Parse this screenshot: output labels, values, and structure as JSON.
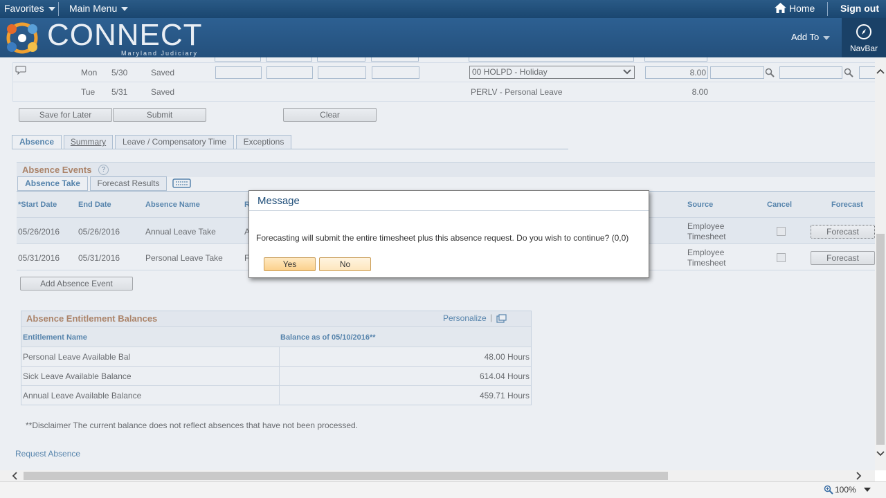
{
  "topbar": {
    "favorites": "Favorites",
    "main_menu": "Main Menu",
    "home": "Home",
    "sign_out": "Sign out"
  },
  "banner": {
    "logo": "CONNECT",
    "logo_sub": "Maryland Judiciary",
    "add_to": "Add To",
    "navbar": "NavBar"
  },
  "timesheet_rows": [
    {
      "day": "Mon",
      "date": "5/30",
      "status": "Saved",
      "trc": "00 HOLPD - Holiday",
      "qty": "8.00"
    },
    {
      "day": "Tue",
      "date": "5/31",
      "status": "Saved",
      "trc": "PERLV - Personal Leave",
      "qty": "8.00"
    }
  ],
  "buttons": {
    "save_later": "Save for Later",
    "submit": "Submit",
    "clear": "Clear",
    "add_absence": "Add Absence Event",
    "forecast": "Forecast"
  },
  "tabs": [
    {
      "label": "Absence"
    },
    {
      "label": "Summary"
    },
    {
      "label": "Leave / Compensatory Time"
    },
    {
      "label": "Exceptions"
    }
  ],
  "absence_events": {
    "title": "Absence Events",
    "subtabs": [
      "Absence Take",
      "Forecast Results"
    ],
    "headers": {
      "start": "*Start Date",
      "end": "End Date",
      "name": "Absence Name",
      "trunc": "R",
      "source": "Source",
      "cancel": "Cancel",
      "forecast": "Forecast"
    },
    "rows": [
      {
        "start": "05/26/2016",
        "end": "05/26/2016",
        "name": "Annual Leave Take",
        "trunc": "A",
        "source1": "Employee",
        "source2": "Timesheet"
      },
      {
        "start": "05/31/2016",
        "end": "05/31/2016",
        "name": "Personal Leave Take",
        "trunc": "F",
        "source1": "Employee",
        "source2": "Timesheet"
      }
    ]
  },
  "balances": {
    "title": "Absence Entitlement Balances",
    "personalize": "Personalize",
    "col1": "Entitlement Name",
    "col2": "Balance as of 05/10/2016**",
    "rows": [
      {
        "name": "Personal Leave Available Bal",
        "value": "48.00 Hours"
      },
      {
        "name": "Sick Leave Available Balance",
        "value": "614.04 Hours"
      },
      {
        "name": "Annual Leave Available Balance",
        "value": "459.71 Hours"
      }
    ]
  },
  "disclaimer": "**Disclaimer  The current balance does not reflect absences that have not been processed.",
  "request_absence": "Request Absence",
  "dialog": {
    "title": "Message",
    "message": "Forecasting will submit the entire timesheet plus this absence request.  Do you wish to continue? (0,0)",
    "yes": "Yes",
    "no": "No"
  },
  "status": {
    "zoom": "100%"
  },
  "colors": {
    "header": "#24507c",
    "accent_link": "#1a5b93",
    "section_title": "#9c5a2b"
  }
}
